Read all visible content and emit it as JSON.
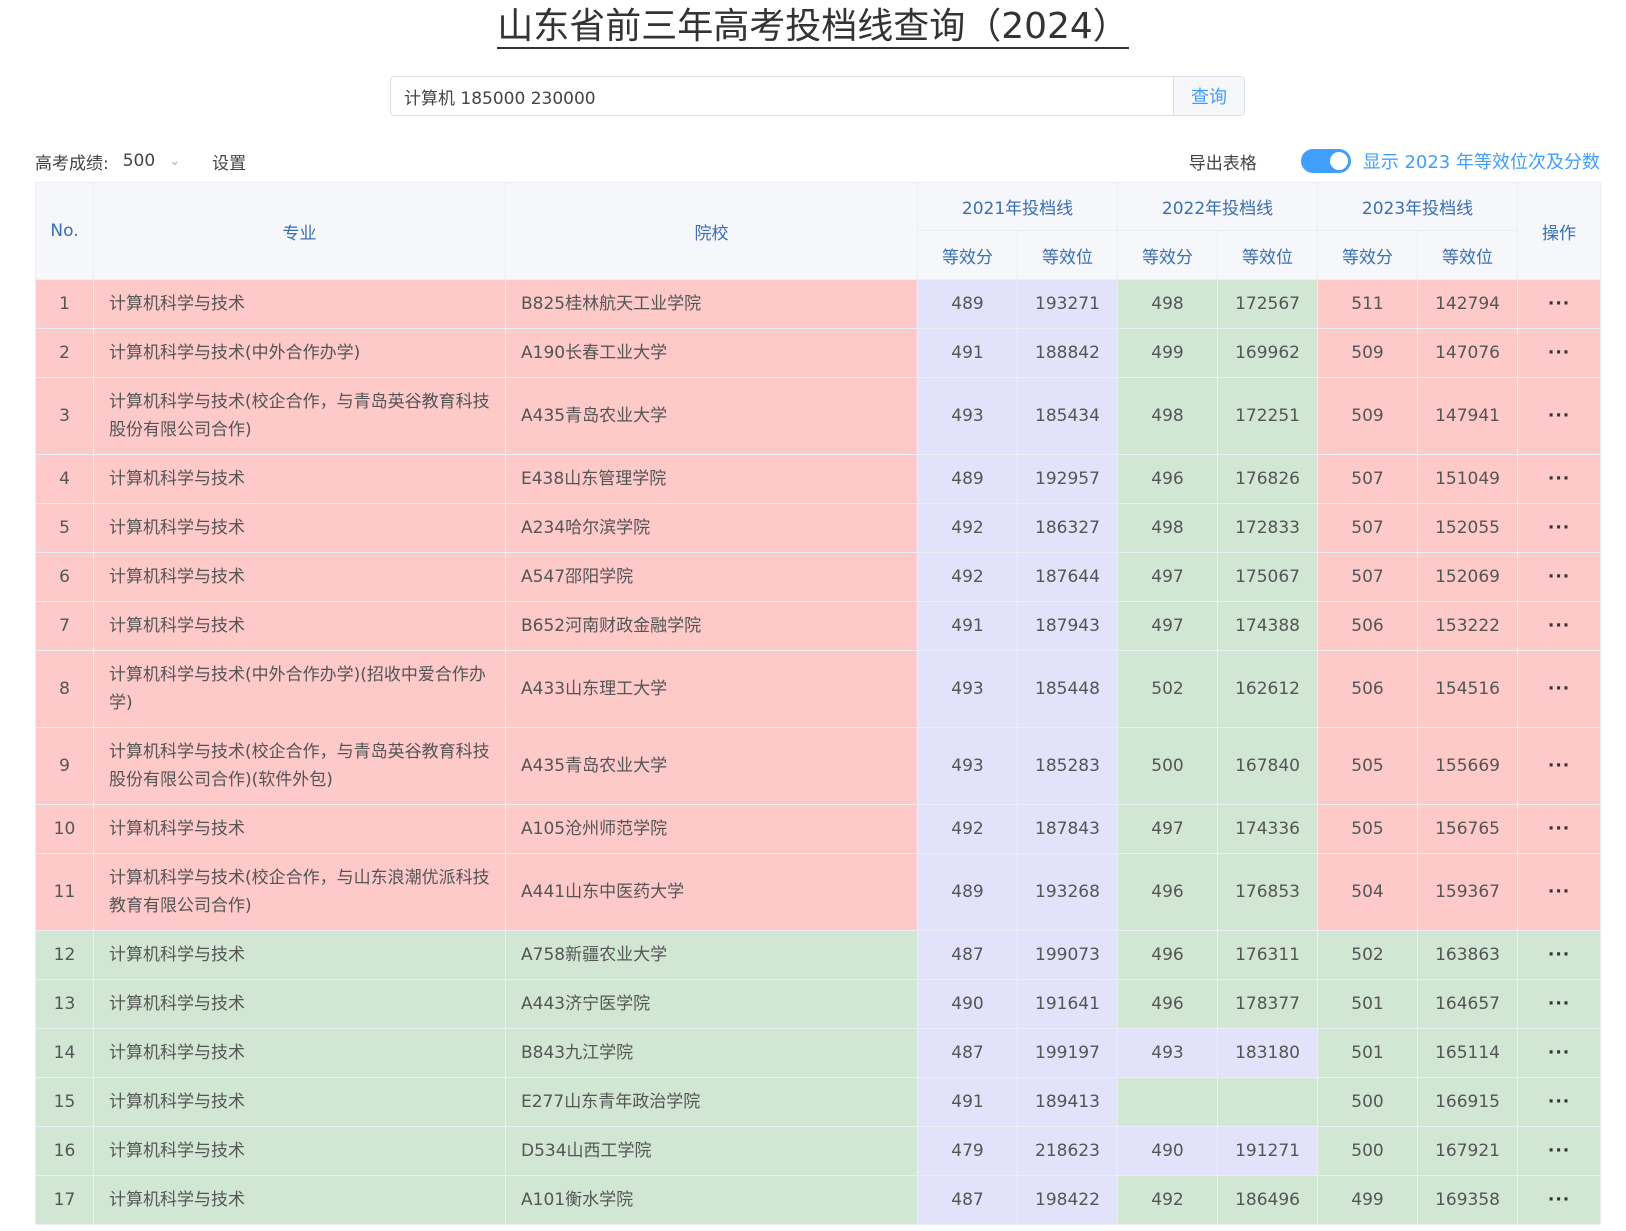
{
  "title": "山东省前三年高考投档线查询（2024）",
  "search": {
    "value": "计算机 185000 230000",
    "button": "查询"
  },
  "toolbar": {
    "score_label": "高考成绩:",
    "score_value": "500",
    "settings": "设置",
    "export": "导出表格",
    "toggle_label": "显示 2023 年等效位次及分数",
    "toggle_on": true
  },
  "colors": {
    "accent": "#409eff",
    "above": "#fdc9c9",
    "below": "#d1e7d4",
    "neutral": "#e2e2fb"
  },
  "table": {
    "headers": {
      "no": "No.",
      "major": "专业",
      "school": "院校",
      "y2021": "2021年投档线",
      "y2022": "2022年投档线",
      "y2023": "2023年投档线",
      "score": "等效分",
      "rank": "等效位",
      "op": "操作"
    },
    "op_icon": "···",
    "rows": [
      {
        "no": "1",
        "major": "计算机科学与技术",
        "school": "B825桂林航天工业学院",
        "s21": "489",
        "r21": "193271",
        "s22": "498",
        "r22": "172567",
        "s23": "511",
        "r23": "142794"
      },
      {
        "no": "2",
        "major": "计算机科学与技术(中外合作办学)",
        "school": "A190长春工业大学",
        "s21": "491",
        "r21": "188842",
        "s22": "499",
        "r22": "169962",
        "s23": "509",
        "r23": "147076"
      },
      {
        "no": "3",
        "major": "计算机科学与技术(校企合作，与青岛英谷教育科技股份有限公司合作)",
        "school": "A435青岛农业大学",
        "s21": "493",
        "r21": "185434",
        "s22": "498",
        "r22": "172251",
        "s23": "509",
        "r23": "147941"
      },
      {
        "no": "4",
        "major": "计算机科学与技术",
        "school": "E438山东管理学院",
        "s21": "489",
        "r21": "192957",
        "s22": "496",
        "r22": "176826",
        "s23": "507",
        "r23": "151049"
      },
      {
        "no": "5",
        "major": "计算机科学与技术",
        "school": "A234哈尔滨学院",
        "s21": "492",
        "r21": "186327",
        "s22": "498",
        "r22": "172833",
        "s23": "507",
        "r23": "152055"
      },
      {
        "no": "6",
        "major": "计算机科学与技术",
        "school": "A547邵阳学院",
        "s21": "492",
        "r21": "187644",
        "s22": "497",
        "r22": "175067",
        "s23": "507",
        "r23": "152069"
      },
      {
        "no": "7",
        "major": "计算机科学与技术",
        "school": "B652河南财政金融学院",
        "s21": "491",
        "r21": "187943",
        "s22": "497",
        "r22": "174388",
        "s23": "506",
        "r23": "153222"
      },
      {
        "no": "8",
        "major": "计算机科学与技术(中外合作办学)(招收中爱合作办学)",
        "school": "A433山东理工大学",
        "s21": "493",
        "r21": "185448",
        "s22": "502",
        "r22": "162612",
        "s23": "506",
        "r23": "154516"
      },
      {
        "no": "9",
        "major": "计算机科学与技术(校企合作，与青岛英谷教育科技股份有限公司合作)(软件外包)",
        "school": "A435青岛农业大学",
        "s21": "493",
        "r21": "185283",
        "s22": "500",
        "r22": "167840",
        "s23": "505",
        "r23": "155669"
      },
      {
        "no": "10",
        "major": "计算机科学与技术",
        "school": "A105沧州师范学院",
        "s21": "492",
        "r21": "187843",
        "s22": "497",
        "r22": "174336",
        "s23": "505",
        "r23": "156765"
      },
      {
        "no": "11",
        "major": "计算机科学与技术(校企合作，与山东浪潮优派科技教育有限公司合作)",
        "school": "A441山东中医药大学",
        "s21": "489",
        "r21": "193268",
        "s22": "496",
        "r22": "176853",
        "s23": "504",
        "r23": "159367"
      },
      {
        "no": "12",
        "major": "计算机科学与技术",
        "school": "A758新疆农业大学",
        "s21": "487",
        "r21": "199073",
        "s22": "496",
        "r22": "176311",
        "s23": "502",
        "r23": "163863"
      },
      {
        "no": "13",
        "major": "计算机科学与技术",
        "school": "A443济宁医学院",
        "s21": "490",
        "r21": "191641",
        "s22": "496",
        "r22": "178377",
        "s23": "501",
        "r23": "164657"
      },
      {
        "no": "14",
        "major": "计算机科学与技术",
        "school": "B843九江学院",
        "s21": "487",
        "r21": "199197",
        "s22": "493",
        "r22": "183180",
        "s23": "501",
        "r23": "165114"
      },
      {
        "no": "15",
        "major": "计算机科学与技术",
        "school": "E277山东青年政治学院",
        "s21": "491",
        "r21": "189413",
        "s22": "",
        "r22": "",
        "s23": "500",
        "r23": "166915"
      },
      {
        "no": "16",
        "major": "计算机科学与技术",
        "school": "D534山西工学院",
        "s21": "479",
        "r21": "218623",
        "s22": "490",
        "r22": "191271",
        "s23": "500",
        "r23": "167921"
      },
      {
        "no": "17",
        "major": "计算机科学与技术",
        "school": "A101衡水学院",
        "s21": "487",
        "r21": "198422",
        "s22": "492",
        "r22": "186496",
        "s23": "499",
        "r23": "169358"
      }
    ]
  }
}
